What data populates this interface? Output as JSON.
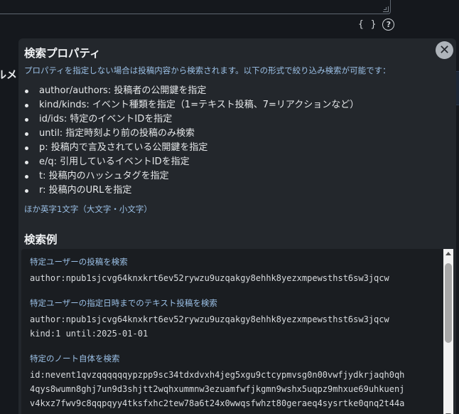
{
  "editor": {
    "toolbar": {
      "json_icon_label": "{ }",
      "help_icon_label": "?"
    }
  },
  "side_fragment": "ルメ",
  "panel": {
    "title": "検索プロパティ",
    "description": "プロパティを指定しない場合は投稿内容から検索されます。以下の形式で絞り込み検索が可能です：",
    "close_label": "✕",
    "filters": [
      "author/authors: 投稿者の公開鍵を指定",
      "kind/kinds: イベント種類を指定（1=テキスト投稿、7=リアクションなど）",
      "id/ids: 特定のイベントIDを指定",
      "until: 指定時刻より前の投稿のみ検索",
      "p: 投稿内で言及されている公開鍵を指定",
      "e/q: 引用しているイベントIDを指定",
      "t: 投稿内のハッシュタグを指定",
      "r: 投稿内のURLを指定"
    ],
    "misc_note": "ほか英字1文字（大文字・小文字）",
    "examples_title": "検索例",
    "examples": [
      {
        "label": "特定ユーザーの投稿を検索",
        "code": "author:npub1sjcvg64knxkrt6ev52rywzu9uzqakgy8ehhk8yezxmpewsthst6sw3jqcw"
      },
      {
        "label": "特定ユーザーの指定日時までのテキスト投稿を検索",
        "code": "author:npub1sjcvg64knxkrt6ev52rywzu9uzqakgy8ehhk8yezxmpewsthst6sw3jqcw\nkind:1 until:2025-01-01"
      },
      {
        "label": "特定のノート自体を検索",
        "code": "id:nevent1qvzqqqqqqypzpp9sc34tdxdvxh4jeg5xgu9ctcypmvsg0n00vwfjydkrjaqh0qh\n4qys8wumn8ghj7un9d3shjtt2wqhxummnw3ezuamfwfjkgmn9wshx5uqpz9mhxue69uhkuenj\nv4kxz7fwv9c8qqpqyy4tksfxhc2tew78a6t24x0wwqsfwhzt80geraeq4sysrtke0qnq2t44a"
      }
    ]
  }
}
